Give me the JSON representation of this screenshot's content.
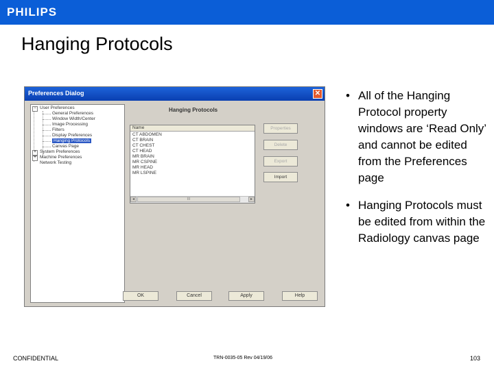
{
  "header": {
    "logo": "PHILIPS",
    "brand_color": "#0b5ed7"
  },
  "slide": {
    "title": "Hanging Protocols"
  },
  "dialog": {
    "title": "Preferences Dialog",
    "close_label": "✕",
    "panel_title": "Hanging Protocols",
    "tree": {
      "user_preferences": "User Preferences",
      "children": [
        "General Preferences",
        "Window Width/Center",
        "Image Processing",
        "Filters",
        "Display Preferences",
        "Hanging Protocols",
        "Canvas Page"
      ],
      "selected_index": 5,
      "system_preferences": "System Preferences",
      "machine_preferences": "Machine Preferences",
      "network_testing": "Network Testing"
    },
    "list": {
      "header": "Name",
      "items": [
        "CT ABDOMEN",
        "CT BRAIN",
        "CT CHEST",
        "CT HEAD",
        "MR BRAIN",
        "MR CSPINE",
        "MR HEAD",
        "MR LSPINE"
      ],
      "scroll_left": "◂",
      "scroll_right": "▸",
      "scroll_thumb": "III"
    },
    "side_buttons": {
      "properties": "Properties",
      "delete": "Delete",
      "export": "Export",
      "import": "Import"
    },
    "bottom_buttons": {
      "ok": "OK",
      "cancel": "Cancel",
      "apply": "Apply",
      "help": "Help"
    }
  },
  "bullets": [
    "All of the Hanging Protocol property windows are ‘Read Only’ and cannot be edited from the Preferences page",
    "Hanging Protocols must be edited from within the Radiology canvas page"
  ],
  "bullet_symbol": "•",
  "footer": {
    "left": "CONFIDENTIAL",
    "middle": "TRN-0035-05 Rev 04/19/06",
    "page": "103"
  }
}
